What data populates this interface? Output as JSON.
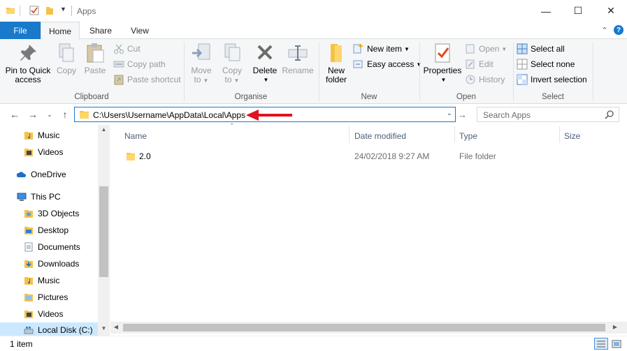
{
  "window": {
    "title": "Apps",
    "minimize_glyph": "—",
    "maximize_glyph": "☐",
    "close_glyph": "✕"
  },
  "tabs": {
    "file": "File",
    "home": "Home",
    "share": "Share",
    "view": "View"
  },
  "ribbon": {
    "clipboard": {
      "label": "Clipboard",
      "pin_line1": "Pin to Quick",
      "pin_line2": "access",
      "copy": "Copy",
      "paste": "Paste",
      "cut": "Cut",
      "copy_path": "Copy path",
      "paste_shortcut": "Paste shortcut"
    },
    "organise": {
      "label": "Organise",
      "move_to": "Move",
      "move_to_2": "to",
      "copy_to": "Copy",
      "copy_to_2": "to",
      "delete": "Delete",
      "rename": "Rename"
    },
    "new": {
      "label": "New",
      "new_folder_1": "New",
      "new_folder_2": "folder",
      "new_item": "New item",
      "easy_access": "Easy access"
    },
    "open": {
      "label": "Open",
      "properties": "Properties",
      "open": "Open",
      "edit": "Edit",
      "history": "History"
    },
    "select": {
      "label": "Select",
      "select_all": "Select all",
      "select_none": "Select none",
      "invert_selection": "Invert selection"
    }
  },
  "address": {
    "path": "C:\\Users\\Username\\AppData\\Local\\Apps",
    "search_placeholder": "Search Apps"
  },
  "nav": {
    "items": [
      {
        "label": "Music",
        "icon": "music-folder-icon"
      },
      {
        "label": "Videos",
        "icon": "videos-folder-icon"
      },
      {
        "label": "OneDrive",
        "icon": "onedrive-icon"
      },
      {
        "label": "This PC",
        "icon": "this-pc-icon"
      },
      {
        "label": "3D Objects",
        "icon": "3d-objects-folder-icon"
      },
      {
        "label": "Desktop",
        "icon": "desktop-folder-icon"
      },
      {
        "label": "Documents",
        "icon": "documents-folder-icon"
      },
      {
        "label": "Downloads",
        "icon": "downloads-folder-icon"
      },
      {
        "label": "Music",
        "icon": "music-folder-icon"
      },
      {
        "label": "Pictures",
        "icon": "pictures-folder-icon"
      },
      {
        "label": "Videos",
        "icon": "videos-folder-icon"
      },
      {
        "label": "Local Disk (C:)",
        "icon": "local-disk-icon"
      }
    ]
  },
  "columns": {
    "name": "Name",
    "date_modified": "Date modified",
    "type": "Type",
    "size": "Size"
  },
  "files": [
    {
      "name": "2.0",
      "date_modified": "24/02/2018 9:27 AM",
      "type": "File folder",
      "size": ""
    }
  ],
  "status": {
    "count": "1 item"
  },
  "colors": {
    "accent": "#1979ca",
    "annotation_arrow": "#e0141e",
    "folder": "#f6c244",
    "selection": "#cce8ff"
  }
}
